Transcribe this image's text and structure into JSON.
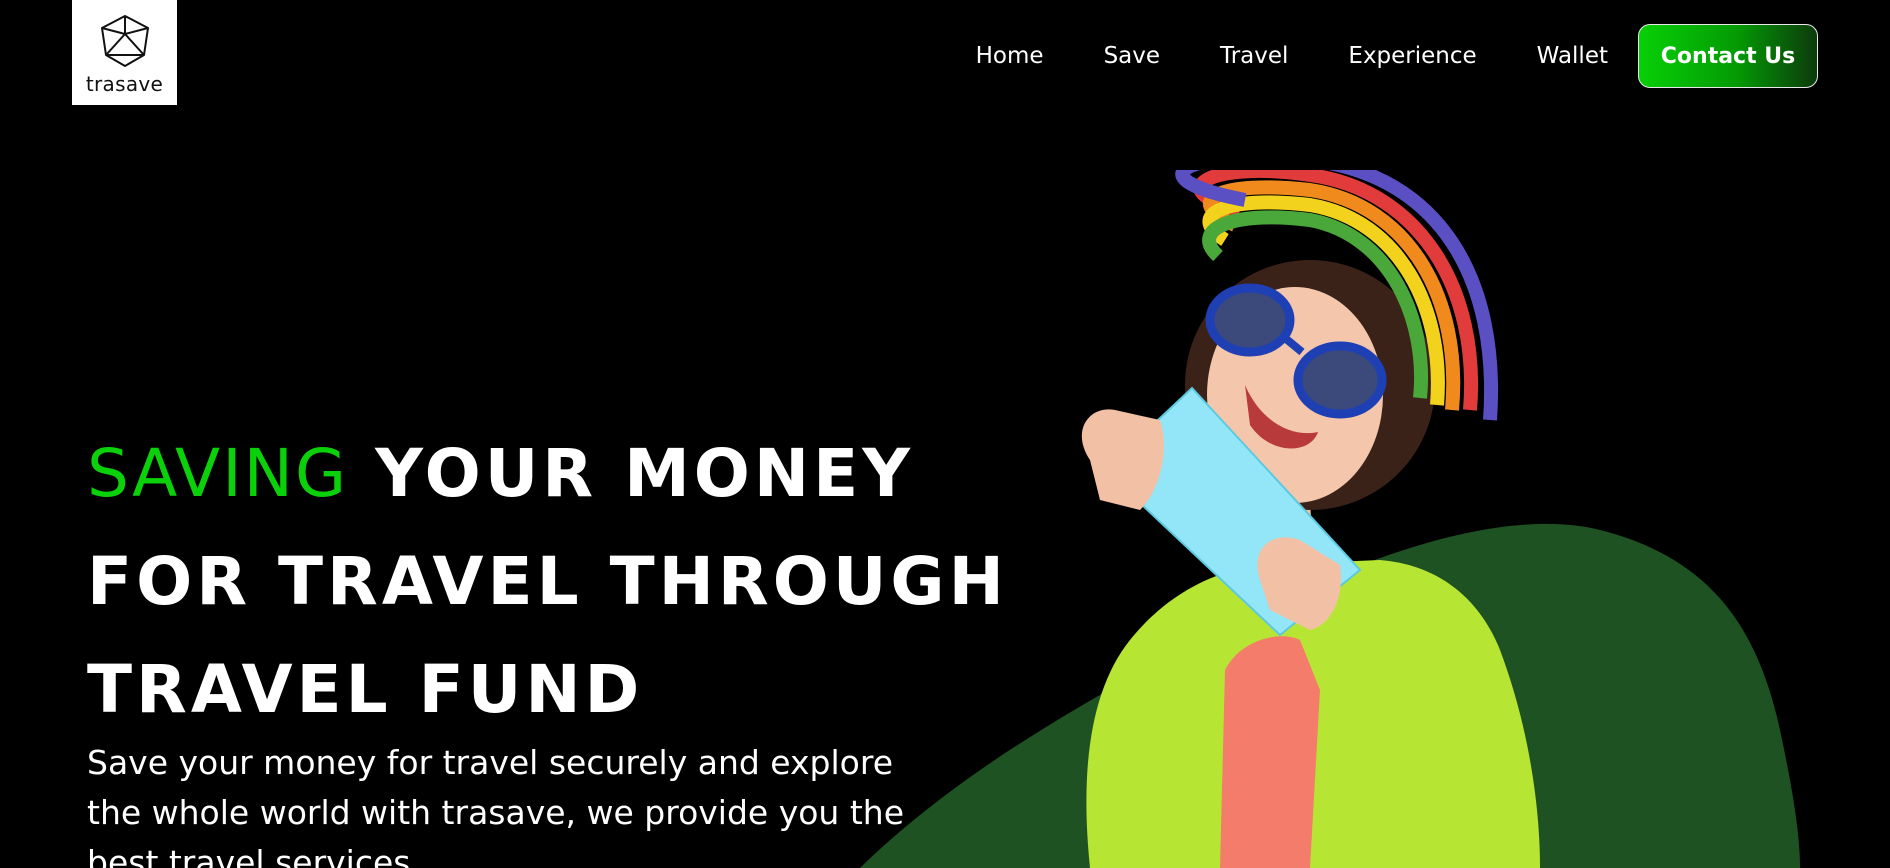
{
  "brand": {
    "name": "trasave"
  },
  "nav": {
    "links": [
      {
        "label": "Home"
      },
      {
        "label": "Save"
      },
      {
        "label": "Travel"
      },
      {
        "label": "Experience"
      },
      {
        "label": "Wallet"
      }
    ],
    "cta_label": "Contact Us"
  },
  "hero": {
    "title_accent": "SAVING",
    "title_line1_rest": "YOUR MONEY",
    "title_line2": "FOR TRAVEL THROUGH",
    "title_line3": "TRAVEL FUND",
    "subtitle": "Save your money for travel securely and explore the whole world with trasave, we provide you the best travel services."
  },
  "colors": {
    "background": "#000000",
    "accent": "#0ad10a",
    "blob": "#1f5222"
  },
  "icons": {
    "logo": "cube-logo-icon"
  }
}
